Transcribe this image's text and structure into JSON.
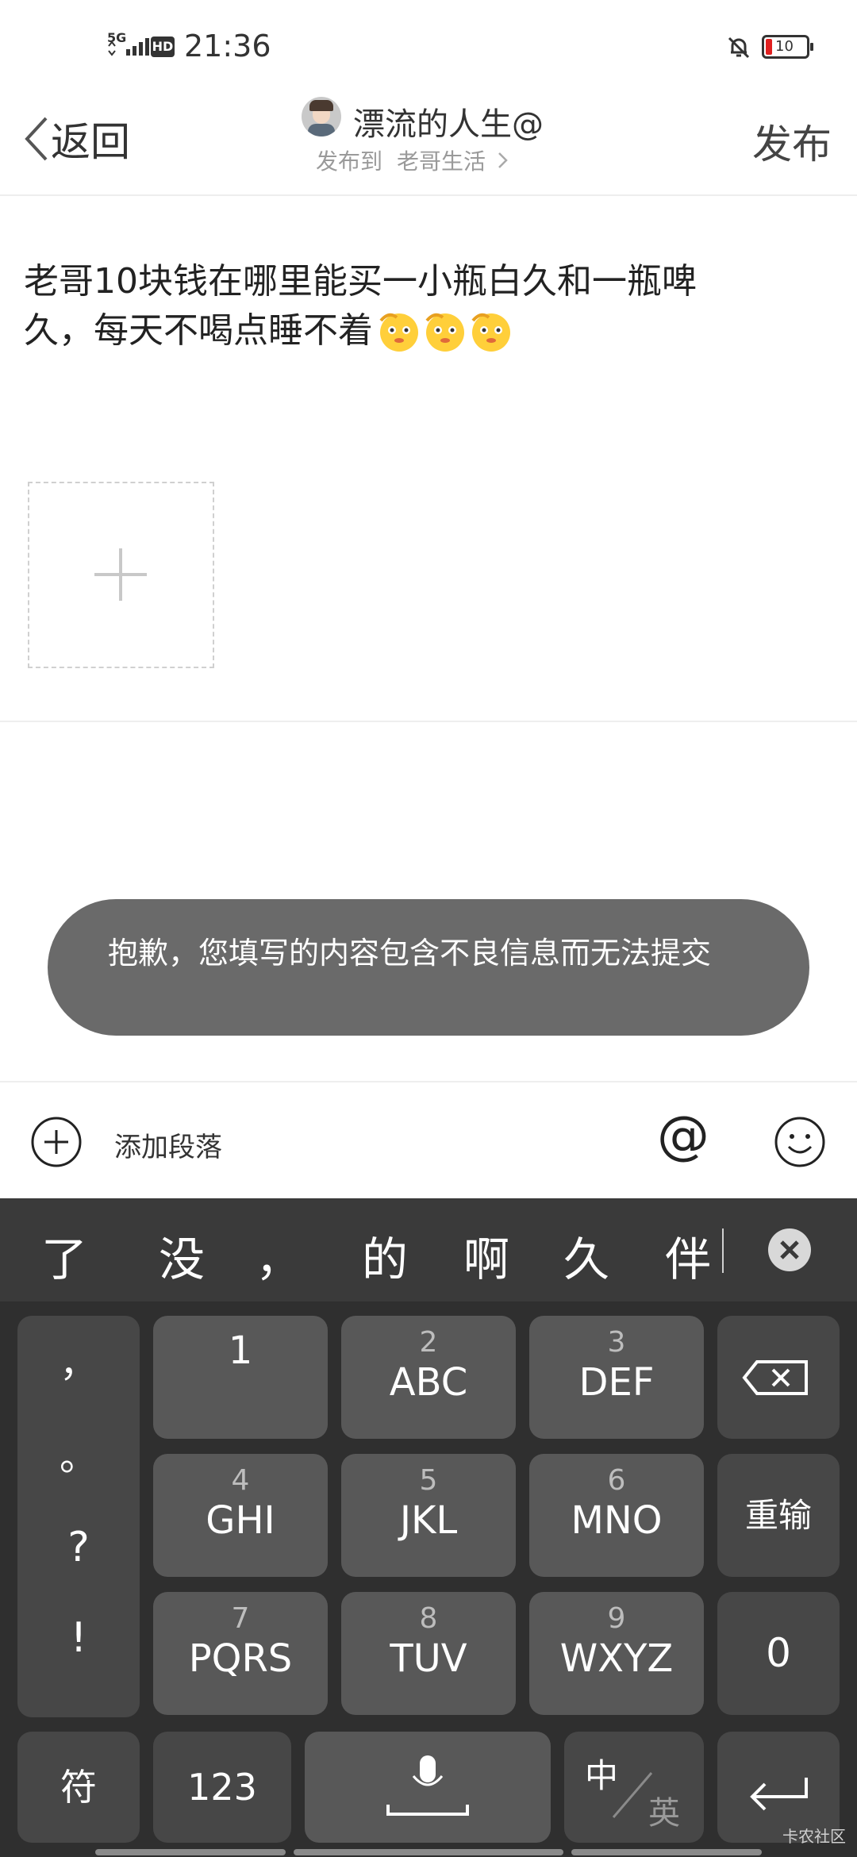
{
  "status_bar": {
    "network": "5G",
    "hd": "HD",
    "time": "21:36",
    "battery": "10"
  },
  "header": {
    "back_label": "返回",
    "username": "漂流的人生@",
    "publish_to_label": "发布到",
    "destination": "老哥生活",
    "publish_label": "发布"
  },
  "post": {
    "line1": "老哥10块钱在哪里能买一小瓶白久和一瓶啤",
    "line2": "久，每天不喝点睡不着"
  },
  "toast": {
    "message": "抱歉，您填写的内容包含不良信息而无法提交"
  },
  "toolbar": {
    "add_paragraph_label": "添加段落",
    "at_label": "@"
  },
  "keyboard": {
    "candidates": [
      "了",
      "没",
      "，",
      "的",
      "啊",
      "久",
      "伴"
    ],
    "punct_keys": [
      "，",
      "。",
      "?",
      "!"
    ],
    "keys": [
      {
        "num": "",
        "letters": "1"
      },
      {
        "num": "2",
        "letters": "ABC"
      },
      {
        "num": "3",
        "letters": "DEF"
      },
      {
        "num": "4",
        "letters": "GHI"
      },
      {
        "num": "5",
        "letters": "JKL"
      },
      {
        "num": "6",
        "letters": "MNO"
      },
      {
        "num": "7",
        "letters": "PQRS"
      },
      {
        "num": "8",
        "letters": "TUV"
      },
      {
        "num": "9",
        "letters": "WXYZ"
      }
    ],
    "retype_label": "重输",
    "zero_label": "0",
    "symbol_label": "符",
    "num_mode_label": "123",
    "lang_zh": "中",
    "lang_en": "英"
  },
  "watermark": "卡农社区"
}
